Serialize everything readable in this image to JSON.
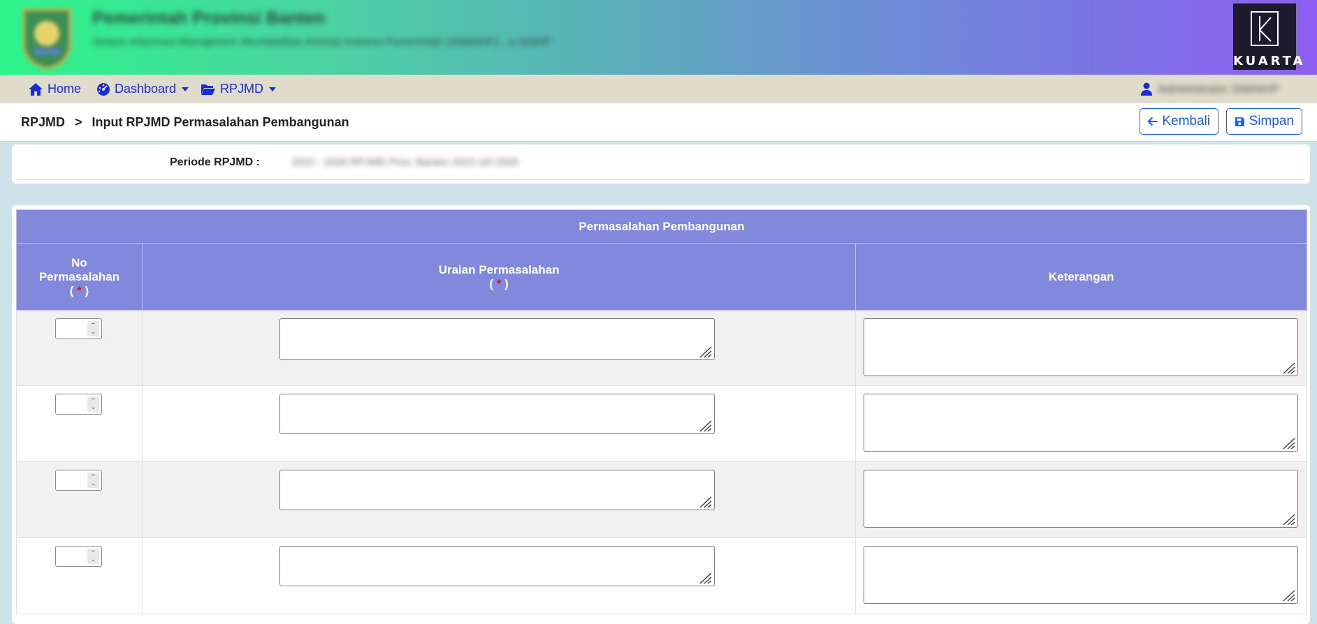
{
  "header": {
    "title": "Pemerintah Provinsi Banten",
    "subtitle": "Sistem Informasi Manajemen Akuntabilitas Kinerja Instansi Pemerintah (SIMAKIP) - e-SAKIP",
    "brand_label": "KUARTA"
  },
  "nav": {
    "home_label": "Home",
    "dashboard_label": "Dashboard",
    "rpjmd_label": "RPJMD",
    "user_name": "Administrator SIMAKIP"
  },
  "breadcrumb": {
    "root": "RPJMD",
    "separator": ">",
    "current": "Input RPJMD Permasalahan Pembangunan"
  },
  "actions": {
    "back_label": "Kembali",
    "save_label": "Simpan"
  },
  "periode": {
    "label": "Periode RPJMD :",
    "value": "2022 - 2026 RPJMD Prov. Banten 2022 s/d 2026"
  },
  "table": {
    "title": "Permasalahan Pembangunan",
    "col_no_line1": "No",
    "col_no_line2": "Permasalahan",
    "col_uraian": "Uraian Permasalahan",
    "col_keterangan": "Keterangan",
    "required_open": "( ",
    "required_mark": "*",
    "required_close": " )",
    "rows": [
      {
        "no": "",
        "uraian": "",
        "keterangan": ""
      },
      {
        "no": "",
        "uraian": "",
        "keterangan": ""
      },
      {
        "no": "",
        "uraian": "",
        "keterangan": ""
      },
      {
        "no": "",
        "uraian": "",
        "keterangan": ""
      }
    ]
  },
  "colors": {
    "table_header": "#8289dc",
    "nav_bg": "#dfdccb",
    "link": "#1a2bd6",
    "button": "#1a5ce0"
  }
}
